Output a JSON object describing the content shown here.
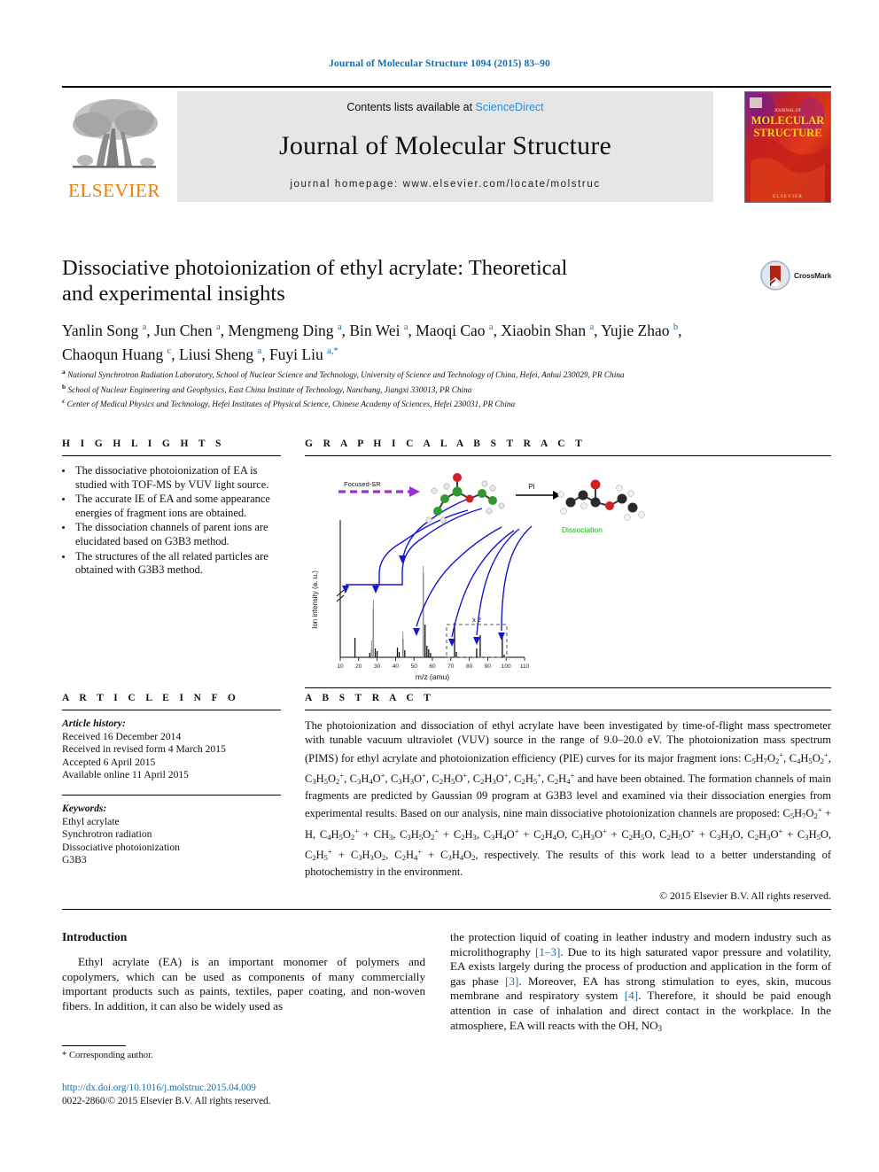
{
  "running_head": "Journal of Molecular Structure 1094 (2015) 83–90",
  "masthead": {
    "contents_prefix": "Contents lists available at",
    "sciencedirect": "ScienceDirect",
    "journal_title": "Journal of Molecular Structure",
    "homepage": "journal homepage: www.elsevier.com/locate/molstruc",
    "publisher_wordmark": "ELSEVIER",
    "cover_line1": "JOURNAL OF",
    "cover_line2": "MOLECULAR",
    "cover_line3": "STRUCTURE",
    "cover_footer": "ELSEVIER"
  },
  "article": {
    "title_line1": "Dissociative photoionization of ethyl acrylate: Theoretical",
    "title_line2": "and experimental insights",
    "crossmark_label": "CrossMark",
    "authors_line1": "Yanlin Song a, Jun Chen a, Mengmeng Ding a, Bin Wei a, Maoqi Cao a, Xiaobin Shan a, Yujie Zhao b,",
    "authors_line2": "Chaoqun Huang c, Liusi Sheng a, Fuyi Liu a,*",
    "affiliations": [
      {
        "marker": "a",
        "text": "National Synchrotron Radiation Laboratory, School of Nuclear Science and Technology, University of Science and Technology of China, Hefei, Anhui 230029, PR China"
      },
      {
        "marker": "b",
        "text": "School of Nuclear Engineering and Geophysics, East China Institute of Technology, Nanchang, Jiangxi 330013, PR China"
      },
      {
        "marker": "c",
        "text": "Center of Medical Physics and Technology, Hefei Institutes of Physical Science, Chinese Academy of Sciences, Hefei 230031, PR China"
      }
    ]
  },
  "highlights": {
    "heading": "H I G H L I G H T S",
    "items": [
      "The dissociative photoionization of EA is studied with TOF-MS by VUV light source.",
      "The accurate IE of EA and some appearance energies of fragment ions are obtained.",
      "The dissociation channels of parent ions are elucidated based on G3B3 method.",
      "The structures of the all related particles are obtained with G3B3 method."
    ]
  },
  "graphical_abstract": {
    "heading": "G R A P H I C A L   A B S T R A C T",
    "label_source": "Focused-SR",
    "label_pi": "PI",
    "label_dissociation": "Dissociation",
    "label_scale": "x 2",
    "ylabel": "Ion intensity (a. u.)",
    "xlabel": "m/z (amu)"
  },
  "chart_data": {
    "type": "bar",
    "title": "",
    "xlabel": "m/z (amu)",
    "ylabel": "Ion intensity (a. u.)",
    "xlim": [
      10,
      110
    ],
    "ylim": [
      0,
      100
    ],
    "xticks": [
      10,
      20,
      30,
      40,
      50,
      60,
      70,
      80,
      90,
      100,
      110
    ],
    "grid": false,
    "legend": "none",
    "annotations": [
      "x 2",
      "Focused-SR",
      "PI",
      "Dissociation"
    ],
    "x": [
      18,
      26,
      27,
      28,
      29,
      41,
      44,
      45,
      55,
      56,
      57,
      58,
      59,
      72,
      73,
      84,
      85,
      99,
      100
    ],
    "values": [
      14,
      3,
      37,
      6,
      5,
      7,
      15,
      4,
      72,
      22,
      9,
      6,
      4,
      26,
      4,
      5,
      12,
      11,
      3
    ]
  },
  "article_info": {
    "heading": "A R T I C L E    I N F O",
    "history_label": "Article history:",
    "history": [
      "Received 16 December 2014",
      "Received in revised form 4 March 2015",
      "Accepted 6 April 2015",
      "Available online 11 April 2015"
    ],
    "keywords_label": "Keywords:",
    "keywords": [
      "Ethyl acrylate",
      "Synchrotron radiation",
      "Dissociative photoionization",
      "G3B3"
    ]
  },
  "abstract": {
    "heading": "A B S T R A C T",
    "paragraph_part1": "The photoionization and dissociation of ethyl acrylate have been investigated by time-of-flight mass spectrometer with tunable vacuum ultraviolet (VUV) source in the range of 9.0–20.0 eV. The photoionization mass spectrum (PIMS) for ethyl acrylate and photoionization efficiency (PIE) curves for its major fragment ions: ",
    "fragment_ions": [
      "C5H7O2+",
      "C4H5O2+",
      "C3H5O2+",
      "C3H4O+",
      "C3H3O+",
      "C2H5O+",
      "C2H3O+",
      "C2H5+",
      "C2H4+"
    ],
    "paragraph_part2": " have been obtained. The formation channels of main fragments are predicted by Gaussian 09 program at G3B3 level and examined via their dissociation energies from experimental results. Based on our analysis, nine main dissociative photoionization channels are proposed: ",
    "channels": [
      "C5H7O2+ + H",
      "C4H5O2+ + CH3",
      "C3H5O2+ + C2H3",
      "C3H4O+ + C2H4O",
      "C3H3O+ + C2H5O",
      "C2H5O+ + C3H3O",
      "C2H3O+ + C3H5O",
      "C2H5+ + C3H3O2",
      "C2H4+ + C3H4O2"
    ],
    "paragraph_part3": " respectively. The results of this work lead to a better understanding of photochemistry in the environment.",
    "copyright": "© 2015 Elsevier B.V. All rights reserved."
  },
  "body": {
    "intro_heading": "Introduction",
    "left_paragraph": "Ethyl acrylate (EA) is an important monomer of polymers and copolymers, which can be used as components of many commercially important products such as paints, textiles, paper coating, and non-woven fibers. In addition, it can also be widely used as",
    "right_paragraph_segments": [
      {
        "text": "the protection liquid of coating in leather industry and modern industry such as microlithography "
      },
      {
        "ref": "[1–3]"
      },
      {
        "text": ". Due to its high saturated vapor pressure and volatility, EA exists largely during the process of production and application in the form of gas phase "
      },
      {
        "ref": "[3]"
      },
      {
        "text": ". Moreover, EA has strong stimulation to eyes, skin, mucous membrane and respiratory system "
      },
      {
        "ref": "[4]"
      },
      {
        "text": ". Therefore, it should be paid enough attention in case of inhalation and direct contact in the workplace. In the atmosphere, EA will reacts with the OH, NO"
      },
      {
        "sub": "3"
      }
    ]
  },
  "footer": {
    "corresponding_author": "* Corresponding author.",
    "doi": "http://dx.doi.org/10.1016/j.molstruc.2015.04.009",
    "issn_line": "0022-2860/© 2015 Elsevier B.V. All rights reserved."
  },
  "colors": {
    "link_blue": "#1a6ea8",
    "sciencedirect_blue": "#2a8fd0",
    "elsevier_orange": "#f07d00",
    "band_gray": "#e6e6e6",
    "arrow_blue": "#1414d2",
    "dissoc_green": "#00c000",
    "sr_purple": "#9b30d0"
  }
}
